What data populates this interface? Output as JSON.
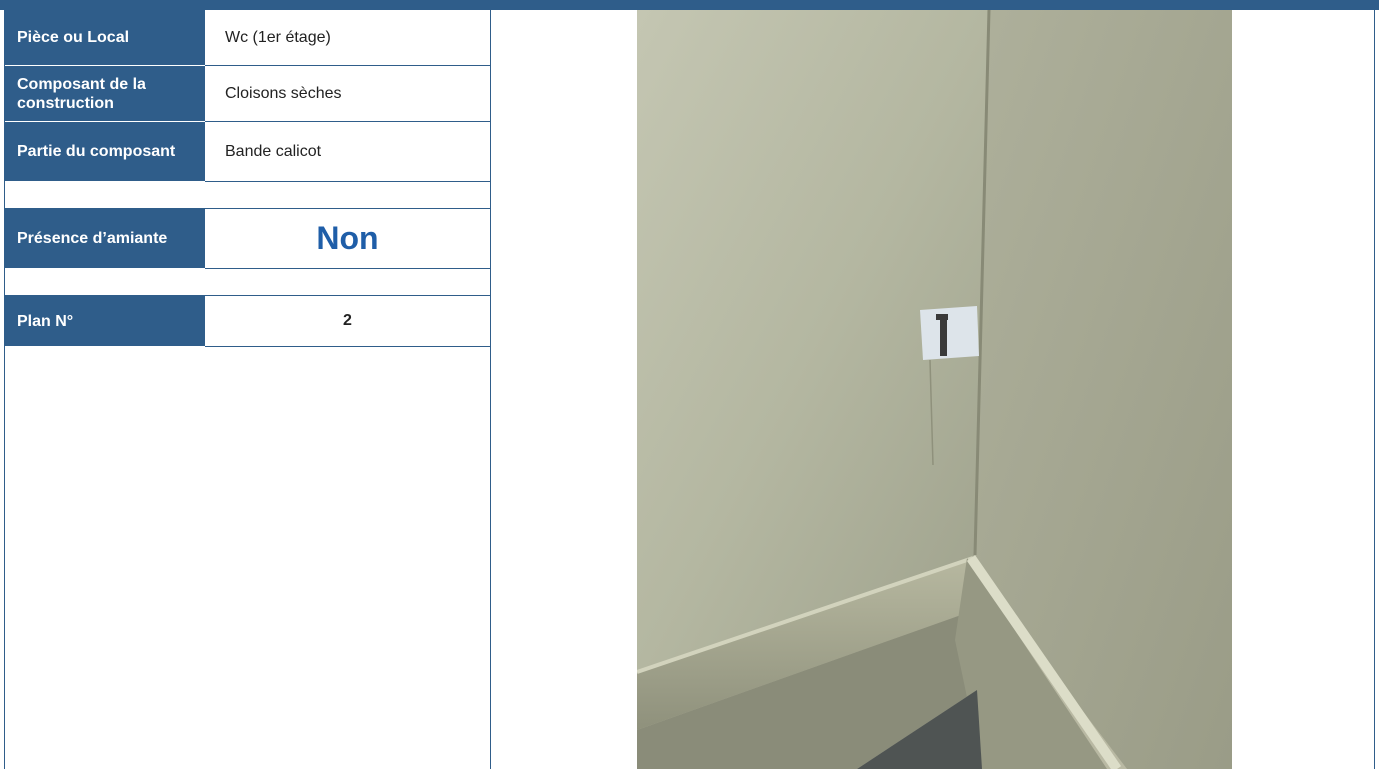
{
  "fields": [
    {
      "label": "Pièce ou Local",
      "value": "Wc (1er étage)"
    },
    {
      "label": "Composant de la construction",
      "value": "Cloisons sèches"
    },
    {
      "label": "Partie du composant",
      "value": "Bande calicot"
    }
  ],
  "asbestos": {
    "label": "Présence d’amiante",
    "value": "Non"
  },
  "plan": {
    "label": "Plan N°",
    "value": "2"
  },
  "colors": {
    "header_blue": "#2f5d8a",
    "accent_blue": "#1f5ea8"
  }
}
